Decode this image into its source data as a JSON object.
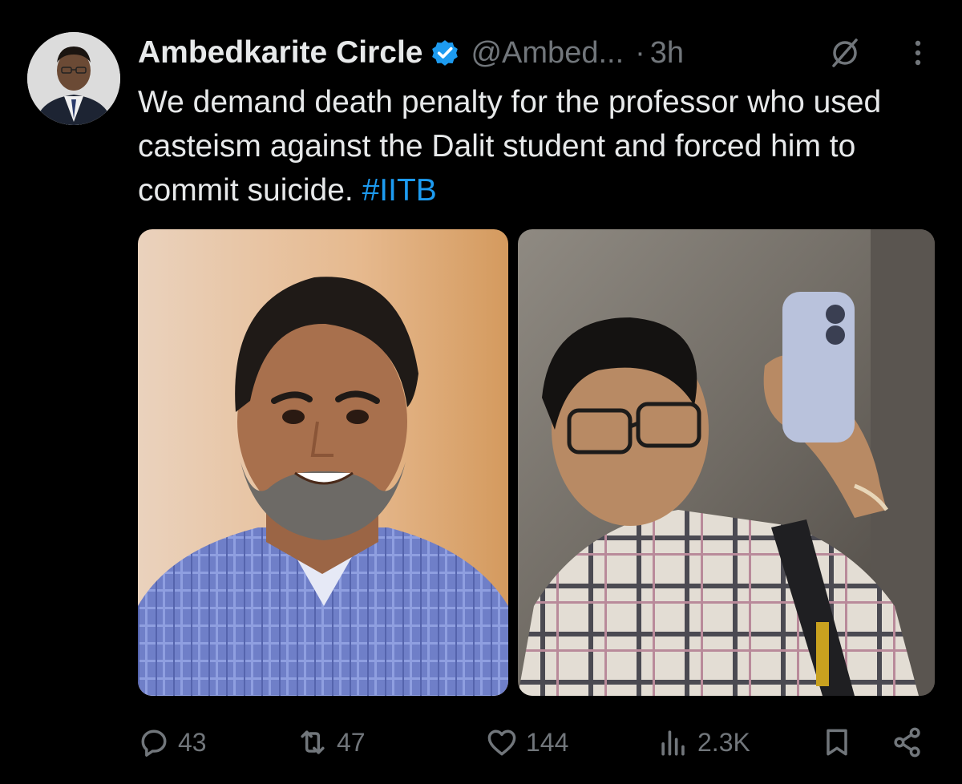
{
  "post": {
    "display_name": "Ambedkarite Circle",
    "handle": "@Ambed...",
    "separator": "·",
    "timestamp": "3h",
    "text": "We demand death penalty for the professor who used casteism against the Dalit student and forced him to commit suicide. ",
    "hashtag": "#IITB"
  },
  "icons": {
    "verified": "verified-badge-icon",
    "grok": "grok-icon",
    "more": "more-options-icon",
    "reply": "reply-icon",
    "repost": "repost-icon",
    "like": "like-icon",
    "views": "views-icon",
    "bookmark": "bookmark-icon",
    "share": "share-icon"
  },
  "actions": {
    "replies": "43",
    "reposts": "47",
    "likes": "144",
    "views": "2.3K"
  },
  "colors": {
    "background": "#000000",
    "text": "#e7e9ea",
    "muted": "#71767b",
    "accent": "#1d9bf0"
  }
}
